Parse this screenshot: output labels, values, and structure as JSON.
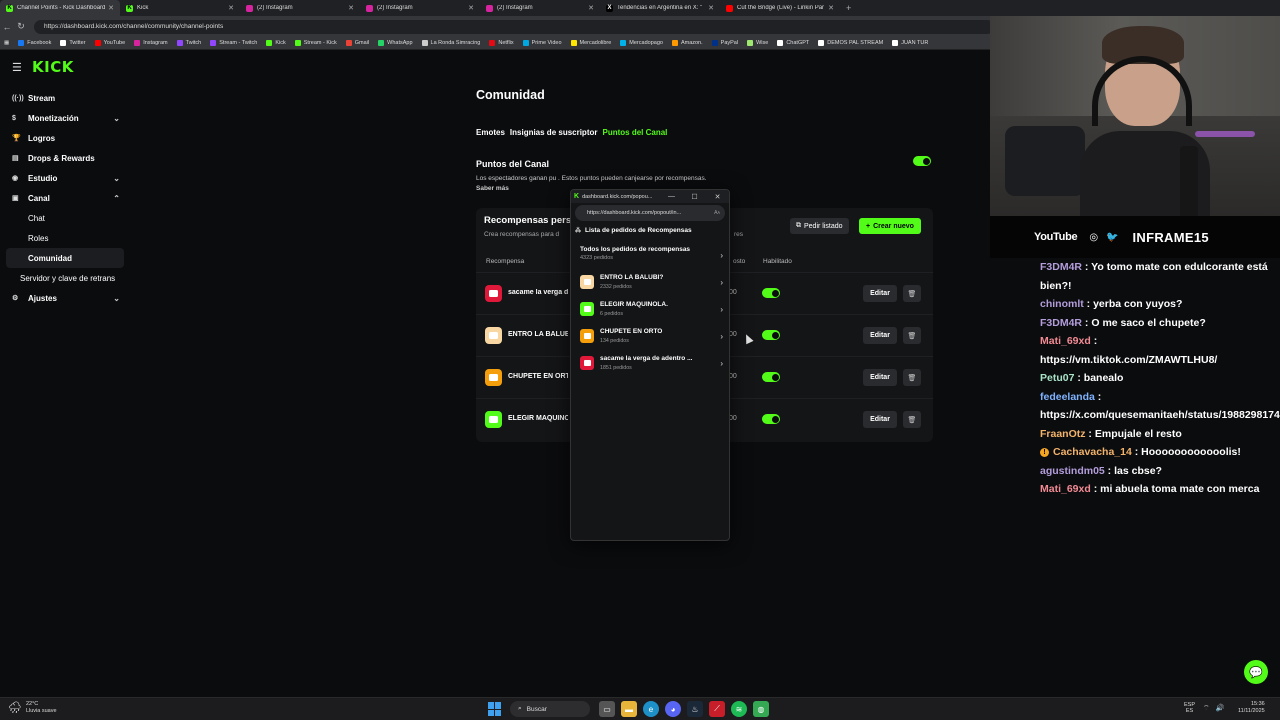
{
  "browser": {
    "tabs": [
      {
        "label": "Channel Points - Kick Dashboard",
        "fav_color": "#53fc18",
        "fav": "K",
        "active": true
      },
      {
        "label": "Kick",
        "fav_color": "#53fc18",
        "fav": "K",
        "active": false
      },
      {
        "label": "(2) Instagram",
        "fav_color": "#d6249f",
        "fav": "",
        "active": false
      },
      {
        "label": "(2) Instagram",
        "fav_color": "#d6249f",
        "fav": "",
        "active": false
      },
      {
        "label": "(2) Instagram",
        "fav_color": "#d6249f",
        "fav": "",
        "active": false
      },
      {
        "label": "Tendencias en Argentina en X: \"",
        "fav_color": "#000000",
        "fav": "X",
        "active": false
      },
      {
        "label": "Cut the Bridge (Live) - Linkin Par",
        "fav_color": "#ff0000",
        "fav": "",
        "active": false
      }
    ],
    "new_tab": "+",
    "url": "https://dashboard.kick.com/channel/community/channel-points",
    "bookmarks": [
      {
        "label": "Facebook",
        "color": "#1877f2"
      },
      {
        "label": "Twitter",
        "color": "#ffffff"
      },
      {
        "label": "YouTube",
        "color": "#ff0000"
      },
      {
        "label": "Instagram",
        "color": "#d6249f"
      },
      {
        "label": "Twitch",
        "color": "#9146ff"
      },
      {
        "label": "Stream - Twitch",
        "color": "#9146ff"
      },
      {
        "label": "Kick",
        "color": "#53fc18"
      },
      {
        "label": "Stream - Kick",
        "color": "#53fc18"
      },
      {
        "label": "Gmail",
        "color": "#ea4335"
      },
      {
        "label": "WhatsApp",
        "color": "#25d366"
      },
      {
        "label": "La Ronda Simracing",
        "color": "#cccccc"
      },
      {
        "label": "Netflix",
        "color": "#e50914"
      },
      {
        "label": "Prime Video",
        "color": "#00a8e1"
      },
      {
        "label": "Mercadolibre",
        "color": "#ffe600"
      },
      {
        "label": "Mercadopago",
        "color": "#00b1ea"
      },
      {
        "label": "Amazon.",
        "color": "#ff9900"
      },
      {
        "label": "PayPal",
        "color": "#003087"
      },
      {
        "label": "Wise",
        "color": "#9fe870"
      },
      {
        "label": "ChatGPT",
        "color": "#ffffff"
      },
      {
        "label": "DEMOS PAL STREAM",
        "color": "#ffffff"
      },
      {
        "label": "JUAN TUR",
        "color": "#ffffff"
      }
    ]
  },
  "kick": {
    "logo": "KICK",
    "sidebar": [
      {
        "label": "Stream",
        "icon": "stream-icon",
        "glyph": "((·))",
        "type": "top"
      },
      {
        "label": "Monetización",
        "icon": "money-icon",
        "glyph": "$",
        "type": "top",
        "chevron": "⌄"
      },
      {
        "label": "Logros",
        "icon": "trophy-icon",
        "glyph": "🏆",
        "type": "top"
      },
      {
        "label": "Drops & Rewards",
        "icon": "gift-icon",
        "glyph": "▤",
        "type": "top"
      },
      {
        "label": "Estudio",
        "icon": "studio-icon",
        "glyph": "◉",
        "type": "top",
        "chevron": "⌄"
      },
      {
        "label": "Canal",
        "icon": "channel-icon",
        "glyph": "▣",
        "type": "top",
        "chevron": "⌃"
      },
      {
        "label": "Chat",
        "type": "sub"
      },
      {
        "label": "Roles",
        "type": "sub"
      },
      {
        "label": "Comunidad",
        "type": "selected"
      },
      {
        "label": "Servidor y clave de retrans",
        "type": "indent"
      },
      {
        "label": "Ajustes",
        "icon": "settings-icon",
        "glyph": "⚙",
        "type": "top",
        "chevron": "⌄"
      }
    ],
    "page_title": "Comunidad",
    "tabs": [
      "Emotes",
      "Insignias de suscriptor",
      "Puntos del Canal"
    ],
    "active_tab": "Puntos del Canal",
    "points": {
      "title": "Puntos del Canal",
      "desc": "Los espectadores ganan pu                                                                             . Estos puntos pueden canjearse por recompensas.",
      "learn_more": "Saber más"
    },
    "rewards": {
      "title": "Recompensas perso",
      "subtitle": "Crea recompensas para d",
      "subtitle_tail": "res",
      "btn_list": "Pedir listado",
      "btn_new": "Crear nuevo",
      "col_reward": "Recompensa",
      "col_cost": "osto",
      "col_enabled": "Habilitado",
      "edit_label": "Editar",
      "rows": [
        {
          "name": "sacame la verga d",
          "cost": "00",
          "color": "#e0183a"
        },
        {
          "name": "ENTRÓ LA BALUBI",
          "cost": "00",
          "color": "#f9d7a3"
        },
        {
          "name": "CHUPETE EN ORTO",
          "cost": "00",
          "color": "#f59e0b"
        },
        {
          "name": "ELEGIR MAQUINOL",
          "cost": "00",
          "color": "#53fc18"
        }
      ]
    }
  },
  "popup": {
    "window_title": "dashboard.kick.com/popou...",
    "url": "https://dashboard.kick.com/popout/in...",
    "url_aa": "Aᴀ",
    "controls": [
      "—",
      "☐",
      "✕"
    ],
    "heading": "Lista de pedidos de Recompensas",
    "all": {
      "title": "Todos los pedidos de recompensas",
      "count": "4323 pedidos"
    },
    "items": [
      {
        "title": "ENTRÓ LA BALUBI?",
        "count": "2332 pedidos",
        "color": "#f9d7a3"
      },
      {
        "title": "ELEGIR MAQUINOLA.",
        "count": "6 pedidos",
        "color": "#53fc18"
      },
      {
        "title": "CHUPETE EN ORTO",
        "count": "134 pedidos",
        "color": "#f59e0b"
      },
      {
        "title": "sacame la verga de adentro ...",
        "count": "1851 pedidos",
        "color": "#e0183a"
      }
    ]
  },
  "stream": {
    "socials": {
      "youtube": "YouTube",
      "name": "INFRAME15"
    },
    "chat": [
      {
        "user": "F3DM4R",
        "color": "#b39ddb",
        "text": "Yo tomo mate con edulcorante está bien?!"
      },
      {
        "user": "chinomlt",
        "color": "#b39ddb",
        "text": "yerba con yuyos?"
      },
      {
        "user": "F3DM4R",
        "color": "#b39ddb",
        "text": "O me saco el chupete?"
      },
      {
        "user": "Mati_69xd",
        "color": "#f28b94",
        "text": "https://vm.tiktok.com/ZMAWTLHU8/"
      },
      {
        "user": "Petu07",
        "color": "#a8e3c7",
        "text": "banealo"
      },
      {
        "user": "fedeelanda",
        "color": "#7fb3ff",
        "text": "https://x.com/quesemanitaeh/status/1988298174692552844"
      },
      {
        "user": "FraanOtz",
        "color": "#f2b36b",
        "text": "Empujale el resto"
      },
      {
        "user": "Cachavacha_14",
        "color": "#f2b36b",
        "text": "Hoooooooooooolis!",
        "badge": "!"
      },
      {
        "user": "agustindm05",
        "color": "#b39ddb",
        "text": "las cbse?"
      },
      {
        "user": "Mati_69xd",
        "color": "#f28b94",
        "text": "mi abuela toma mate con merca"
      }
    ]
  },
  "taskbar": {
    "weather_temp": "22°C",
    "weather_desc": "Lluvia suave",
    "search": "Buscar",
    "lang_top": "ESP",
    "lang_bottom": "ES",
    "time": "15:36",
    "date": "11/11/2025"
  }
}
